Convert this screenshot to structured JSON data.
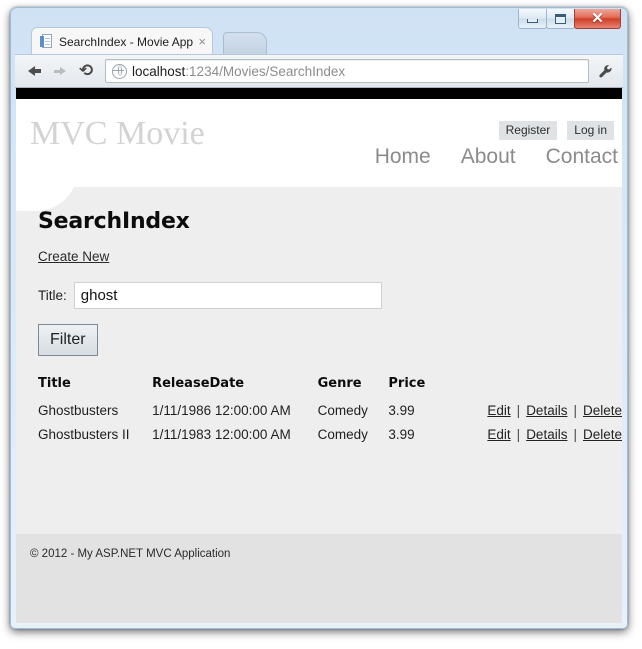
{
  "browser": {
    "window_buttons": {
      "minimize": "minimize-button",
      "maximize": "maximize-button",
      "close": "✕"
    },
    "tab": {
      "title": "SearchIndex - Movie App",
      "close_label": "×"
    },
    "toolbar": {
      "back": "back-arrow",
      "forward": "forward-arrow",
      "reload": "⟳",
      "menu": "wrench-icon"
    },
    "omnibox": {
      "host": "localhost",
      "path": ":1234/Movies/SearchIndex"
    }
  },
  "site": {
    "logo": "MVC Movie",
    "auth": {
      "register": "Register",
      "login": "Log in"
    },
    "nav": [
      {
        "label": "Home"
      },
      {
        "label": "About"
      },
      {
        "label": "Contact"
      }
    ]
  },
  "page": {
    "title": "SearchIndex",
    "create_new": "Create New",
    "filter": {
      "label": "Title:",
      "value": "ghost",
      "placeholder": "",
      "button": "Filter"
    },
    "table": {
      "headers": [
        "Title",
        "ReleaseDate",
        "Genre",
        "Price"
      ],
      "rows": [
        {
          "title": "Ghostbusters",
          "release_date": "1/11/1986 12:00:00 AM",
          "genre": "Comedy",
          "price": "3.99",
          "actions": {
            "edit": "Edit",
            "details": "Details",
            "delete": "Delete",
            "sep": "|"
          }
        },
        {
          "title": "Ghostbusters II",
          "release_date": "1/11/1983 12:00:00 AM",
          "genre": "Comedy",
          "price": "3.99",
          "actions": {
            "edit": "Edit",
            "details": "Details",
            "delete": "Delete",
            "sep": "|"
          }
        }
      ]
    }
  },
  "footer": {
    "copyright": "© 2012 - My ASP.NET MVC Application"
  },
  "colors": {
    "black_bar": "#000000",
    "body_bg": "#eeeeee",
    "footer_bg": "#e2e2e2",
    "logo_gray": "#d3d3d3",
    "nav_gray": "#8b8b8b"
  }
}
